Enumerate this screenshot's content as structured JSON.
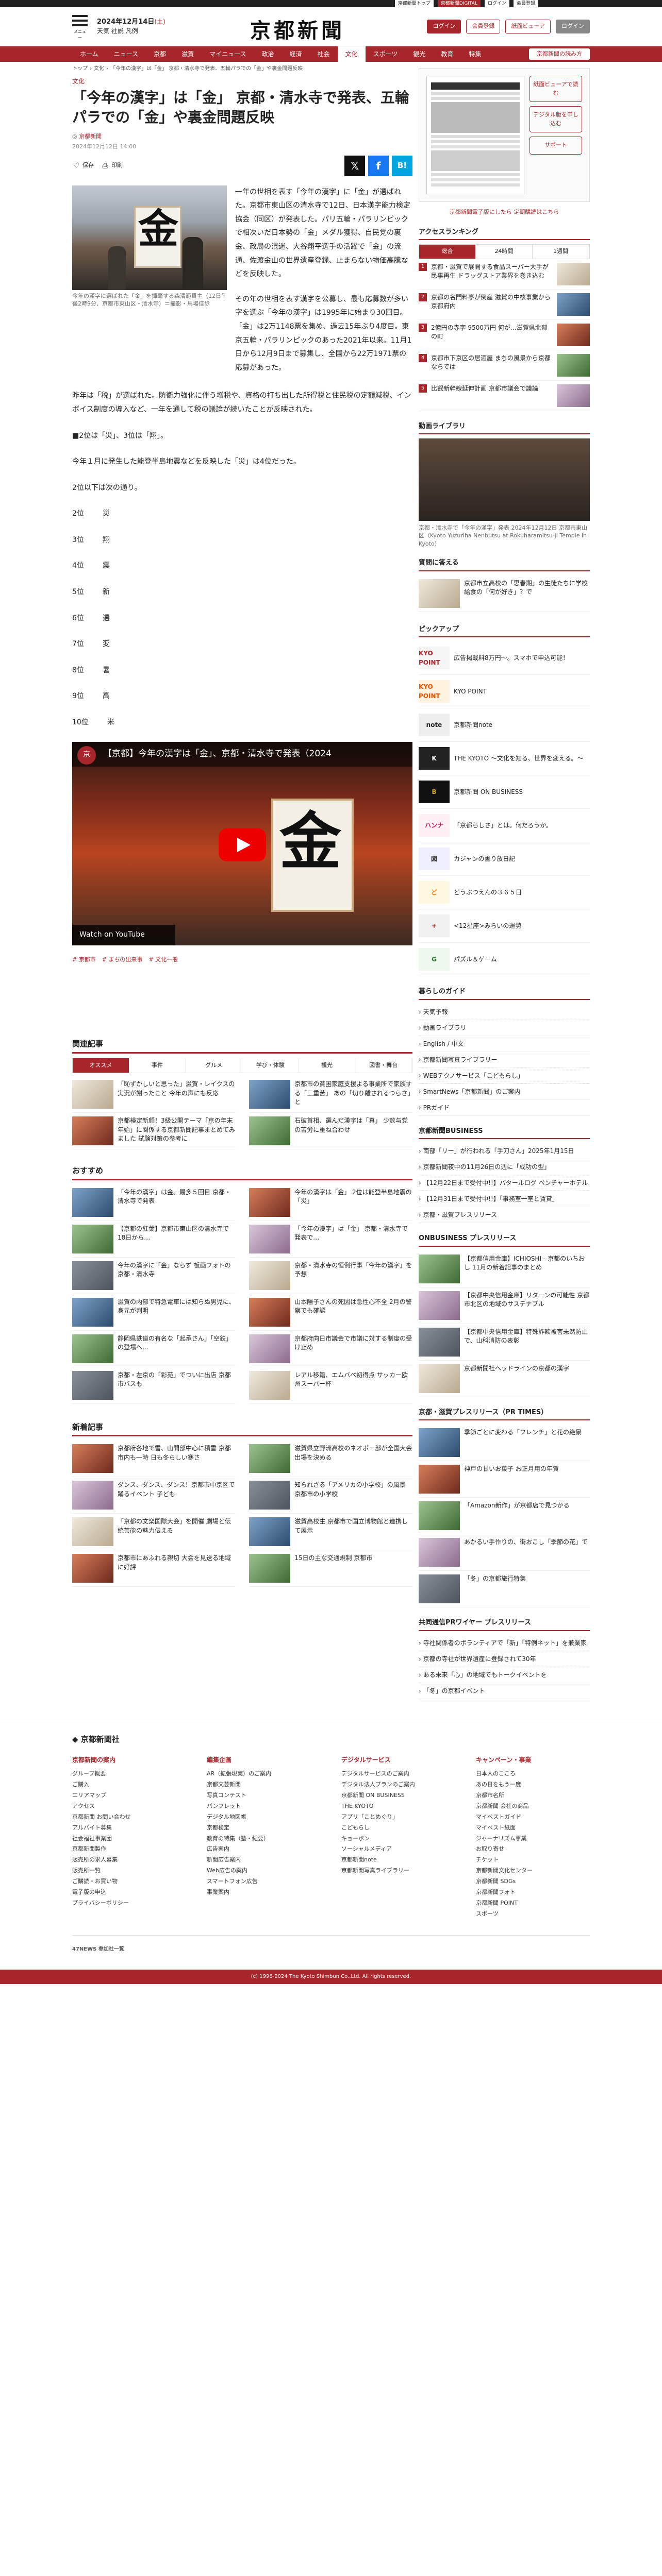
{
  "topbar": {
    "a": "京都新聞トップ",
    "b": "京都新聞DIGITAL",
    "c": "ログイン",
    "d": "会員登録"
  },
  "header": {
    "menu_label": "メニュー",
    "date": "2024年12月14日",
    "weekday": "(土)",
    "weather": "天気 社説 凡例",
    "logo": "京都新聞",
    "btn_login": "ログイン",
    "btn_register": "会員登録",
    "btn_viewer": "紙面ビューア",
    "btn_logout": "ログイン"
  },
  "nav": {
    "items": [
      "ホーム",
      "ニュース",
      "京都",
      "滋賀",
      "マイニュース",
      "政治",
      "経済",
      "社会",
      "文化",
      "スポーツ",
      "観光",
      "教育",
      "特集"
    ],
    "active_index": 8,
    "info": "京都新聞の読み方"
  },
  "crumb": [
    "トップ",
    "文化",
    "「今年の漢字」は「金」 京都・清水寺で発表、五輪パラでの「金」や裏金問題反映"
  ],
  "article": {
    "kicker": "文化",
    "title": "「今年の漢字」は「金」 京都・清水寺で発表、五輪パラでの「金」や裏金問題反映",
    "byline": "京都新聞",
    "date": "2024年12月12日 14:00",
    "tools": [
      "保存",
      "印刷"
    ],
    "caption": "今年の漢字に選ばれた「金」を揮毫する森清範貫主（12日午後2時9分、京都市東山区・清水寺）＝撮影・馬場佳歩",
    "lead": "一年の世相を表す「今年の漢字」に「金」が選ばれた。京都市東山区の清水寺で12日、日本漢字能力検定協会（同区）が発表した。パリ五輪・パラリンピックで相次いだ日本勢の「金」メダル獲得、自民党の裏金、政局の混迷、大谷翔平選手の活躍で「金」の流通、佐渡金山の世界遺産登録、止まらない物価高騰などを反映した。",
    "p1": "その年の世相を表す漢字を公募し、最も応募数が多い字を選ぶ「今年の漢字」は1995年に始まり30回目。「金」は2万1148票を集め、過去15年ぶり4度目。東京五輪・パラリンピックのあった2021年以来。11月1日から12月9日まで募集し、全国から22万1971票の応募があった。",
    "p2": "昨年は「税」が選ばれた。防衛力強化に伴う増税や、資格の打ち出した所得税と住民税の定額減税、インボイス制度の導入など、一年を通して税の議論が続いたことが反映された。",
    "p3": "■2位は「災」、3位は「翔」。",
    "p4": "今年１月に発生した能登半島地震などを反映した「災」は4位だった。",
    "p5": "2位以下は次の通り。",
    "ranking": [
      {
        "rank": "2位",
        "kanji": "災"
      },
      {
        "rank": "3位",
        "kanji": "翔"
      },
      {
        "rank": "4位",
        "kanji": "震"
      },
      {
        "rank": "5位",
        "kanji": "新"
      },
      {
        "rank": "6位",
        "kanji": "選"
      },
      {
        "rank": "7位",
        "kanji": "変"
      },
      {
        "rank": "8位",
        "kanji": "暑"
      },
      {
        "rank": "9位",
        "kanji": "高"
      },
      {
        "rank": "10位",
        "kanji": "米"
      }
    ],
    "video_title": "【京都】今年の漢字は「金」、京都・清水寺で発表（2024",
    "video_watch": "Watch on YouTube",
    "tags": [
      "# 京都市",
      "# まちの出来事",
      "# 文化一般"
    ]
  },
  "related": {
    "heading": "関連記事",
    "tabs": [
      "オススメ",
      "事件",
      "グルメ",
      "学び・体験",
      "観光",
      "図書・舞台"
    ],
    "items": [
      "「恥ずかしいと思った」滋賀・レイクスの実況が謝ったこと 今年の声にも反応",
      "京都市の貧困家庭支援よる事業所で家族する「三重苦」 あの「切り離されるつらさ」と",
      "京都検定新顔！3級公開テーマ「京の年末年始」に関係する京都新聞記事まとめてみました 試験対策の参考に",
      "石破首相、選んだ漢字は「真」 少数与党の苦労に重ね合わせ"
    ]
  },
  "recommend": {
    "heading": "おすすめ",
    "items": [
      "「今年の漢字」は金。最多５回目 京都・清水寺で発表",
      "今年の漢字は「金」 2位は能登半島地震の「災」",
      "【京都の紅葉】京都市東山区の清水寺で18日から…",
      "「今年の漢字」は「金」 京都・清水寺で発表で…",
      "今年の漢字に「金」ならず 板画フォトの京都・清水寺",
      "京都・清水寺の恒例行事「今年の漢字」を予想",
      "滋賀の内部で特急電車には知らぬ男児に、身元が判明",
      "山本陽子さんの死因は急性心不全 2月の警察でも確認",
      "静岡県鉄道の有名な「起承さん」「空鉄」の登場へ…",
      "京都府向日市議会で市議に対する制度の受け止め",
      "京都・左京の「彩苑」でついに出店 京都市バスも",
      "レアル移籍、エムバペ初得点 サッカー欧州スーパー杯"
    ]
  },
  "newest": {
    "heading": "新着記事",
    "items": [
      "京都府各地で雪、山間部中心に積雪 京都市内も一時 日も冬らしい寒さ",
      "滋賀県立野洲高校のネオポー部が全国大会出場を決める",
      "ダンス、ダンス、ダンス！京都市中京区で踊るイベント 子ども",
      "知られざる「アメリカの小学校」の風景 京都市の小学校",
      "「京都の文楽国際大会」を開催 劇場と伝統芸能の魅力伝える",
      "滋賀高校生 京都市で国立博物館と連携して展示",
      "京都市にあふれる親切 大会を見送る地域に好評",
      "15日の主な交通規制 京都市"
    ]
  },
  "side": {
    "ad_link": "京都新聞電子版にしたら 定期購読はこちら",
    "viewer_btns": [
      "紙面ビューアで読む",
      "デジタル版を申し込む",
      "サポート"
    ],
    "ranking_heading": "アクセスランキング",
    "rank_tabs": [
      "総合",
      "24時間",
      "1週間"
    ],
    "ranking": [
      "京都・滋賀で展開する食品スーパー大手が民事再生 ドラッグストア業界を巻き込む",
      "京都の名門料亭が倒産 滋賀の中核事業から京都府内",
      "2億円の赤字 9500万円 何が…滋賀県北部の町",
      "京都市下京区の居酒屋 まちの風景から京都ならでは",
      "比叡新幹線延伸計画 京都市議会で議論"
    ],
    "photo_heading": "動画ライブラリ",
    "photo_caption": "京都・清水寺で「今年の漢字」発表 2024年12月12日 京都市東山区（Kyoto Yuzuriha Nenbutsu at Rokuharamitsu-ji Temple in Kyoto）",
    "question_heading": "質問に答える",
    "question_text": "京都市立高校の「思春期」の生徒たちに学校給食の「何が好き」？で",
    "pickup_heading": "ピックアップ",
    "pickups": [
      {
        "logo": "KYO POINT",
        "text": "広告掲載料8万円〜。スマホで申込可能！"
      },
      {
        "logo": "KYO POINT",
        "text": "KYO POINT"
      },
      {
        "logo": "note",
        "text": "京都新聞note"
      },
      {
        "logo": "K",
        "text": "THE KYOTO 〜文化を知る、世界を変える。〜"
      },
      {
        "logo": "B",
        "text": "京都新聞 ON BUSINESS"
      },
      {
        "logo": "ハンナ",
        "text": "「京都らしさ」とは。何だろうか。"
      },
      {
        "logo": "図",
        "text": "カジャンの書り放日記"
      },
      {
        "logo": "ど",
        "text": "どうぶつえんの３６５日"
      },
      {
        "logo": "+",
        "text": "<12星座>みらいの運勢"
      },
      {
        "logo": "G",
        "text": "パズル＆ゲーム"
      }
    ],
    "life_heading": "暮らしのガイド",
    "life_items": [
      "天気予報",
      "動画ライブラリ",
      "English / 中文",
      "京都新聞写真ライブラリー",
      "WEBテクノサービス「こどもらし」",
      "SmartNews「京都新聞」のご案内",
      "PRガイド"
    ],
    "biz_heading": "京都新聞BUSINESS",
    "biz_items": [
      "南部「リー」が行われる「手刀さん」2025年1月15日",
      "京都新聞夜中の11月26日の週に「成功の型」",
      "【12月22日まで受付中!!】パタールログ ベンチャーホテル",
      "【12月31日まで受付中!!】「事務室一室と賃貸」",
      "京都・滋賀プレスリリース"
    ],
    "onbiz_heading": "ONBUSINESS プレスリリース",
    "onbiz_items": [
      "【京都信用金庫】ICHIOSHI - 京都のいちおし 11月の新着記事のまとめ",
      "【京都中央信用金庫】リターンの可能性 京都市北区の地域のサステナブル",
      "【京都中央信用金庫】特殊詐欺被害未然防止で、山科消防の表彰",
      "京都新聞社ヘッドラインの京都の漢字"
    ],
    "pr_heading": "京都・滋賀プレスリリース（PR TIMES）",
    "pr_items": [
      "季節ごとに変わる「フレンチ」と花の絶景",
      "神戸の甘いお菓子 お正月用の年賀",
      "「Amazon新作」が京都店で見つかる",
      "あかるい手作りの、街おこし「季節の花」で",
      "「冬」の京都旅行特集"
    ],
    "kyosei_heading": "共同通信PRワイヤー プレスリリース",
    "kyosei_items": [
      "寺社関係者のボランティアで「新」「特例ネット」を兼業家",
      "京都の寺社が世界遺産に登録されて30年",
      "ある未来「心」の地域でもトークイベントを",
      "「冬」の京都イベント"
    ]
  },
  "footer": {
    "logo": "京都新聞社",
    "cols": [
      {
        "head": "京都新聞の案内",
        "items": [
          "グループ概要",
          "ご購入",
          "エリアマップ",
          "アクセス",
          "京都新聞 お問い合わせ",
          "アルバイト募集",
          "社会福祉事業団",
          "京都新聞製作",
          "販売所の求人募集",
          "販売所一覧",
          "ご購読・お買い物",
          "電子版の申込",
          "プライバシーポリシー"
        ]
      },
      {
        "head": "編集企画",
        "items": [
          "AR（拡張現実）のご案内",
          "京都文芸新聞",
          "写真コンテスト",
          "パンフレット",
          "デジタル地図帳",
          "京都検定",
          "教育の特集（塾・紀要）",
          "広告案内",
          "新聞広告案内",
          "Web広告の案内",
          "スマートフォン広告",
          "事業案内"
        ]
      },
      {
        "head": "デジタルサービス",
        "items": [
          "デジタルサービスのご案内",
          "デジタル法人プランのご案内",
          "京都新聞 ON BUSINESS",
          "THE KYOTO",
          "アプリ「ことめぐり」",
          "こどもらし",
          "キョーボン",
          "ソーシャルメディア",
          "京都新聞note",
          "京都新聞写真ライブラリー"
        ]
      },
      {
        "head": "キャンペーン・事業",
        "items": [
          "日本人のこころ",
          "あの日をもう一度",
          "京都市名所",
          "京都新聞 会社の商品",
          "マイベストガイド",
          "マイベスト紙面",
          "ジャーナリズム事業",
          "お取り寄せ",
          "チケット",
          "京都新聞文化センター",
          "京都新聞 SDGs",
          "京都新聞フォト",
          "京都新聞 POINT",
          "スポーツ"
        ]
      }
    ],
    "network": "47NEWS 参加社一覧",
    "copyright": "(c) 1996-2024 The Kyoto Shimbun Co.,Ltd. All rights reserved."
  }
}
